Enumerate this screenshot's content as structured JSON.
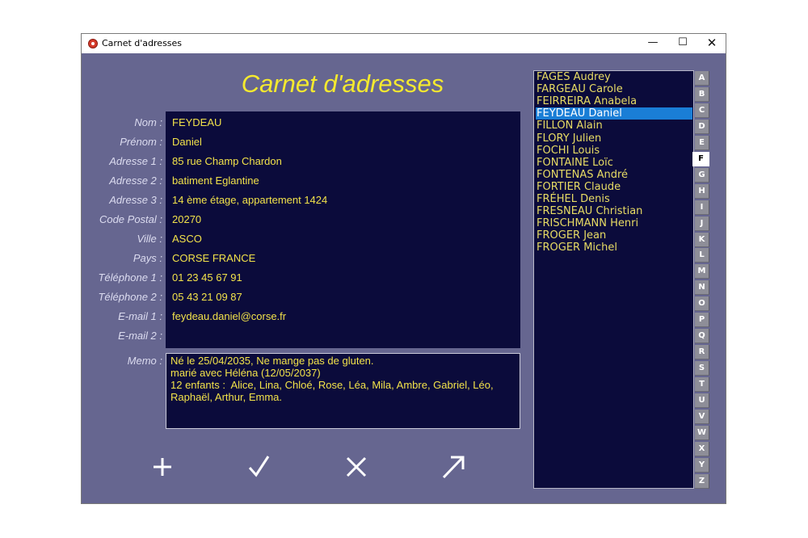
{
  "window": {
    "title": "Carnet d'adresses",
    "minimize": "—",
    "maximize": "☐",
    "close": "✕"
  },
  "header": {
    "title": "Carnet d'adresses"
  },
  "form": {
    "fields": [
      {
        "label": "Nom :",
        "value": "FEYDEAU"
      },
      {
        "label": "Prénom :",
        "value": "Daniel"
      },
      {
        "label": "Adresse 1 :",
        "value": "85 rue Champ Chardon"
      },
      {
        "label": "Adresse 2 :",
        "value": "batiment Eglantine"
      },
      {
        "label": "Adresse 3 :",
        "value": "14 ème étage, appartement 1424"
      },
      {
        "label": "Code Postal :",
        "value": "20270"
      },
      {
        "label": "Ville :",
        "value": "ASCO"
      },
      {
        "label": "Pays :",
        "value": "CORSE FRANCE"
      },
      {
        "label": "Téléphone 1 :",
        "value": "01 23 45 67 91"
      },
      {
        "label": "Téléphone 2 :",
        "value": "05 43 21 09 87"
      },
      {
        "label": "E-mail 1 :",
        "value": "feydeau.daniel@corse.fr"
      },
      {
        "label": "E-mail 2 :",
        "value": ""
      }
    ],
    "memo_label": "Memo :",
    "memo": "Né le 25/04/2035, Ne mange pas de gluten.\nmarié avec Héléna (12/05/2037)\n12 enfants :  Alice, Lina, Chloé, Rose, Léa, Mila, Ambre, Gabriel, Léo,\nRaphaël, Arthur, Emma."
  },
  "actions": [
    {
      "name": "add-icon"
    },
    {
      "name": "validate-icon"
    },
    {
      "name": "cancel-icon"
    },
    {
      "name": "export-icon"
    }
  ],
  "contacts": {
    "items": [
      "FAGES Audrey",
      "FARGEAU Carole",
      "FEIRREIRA Anabela",
      "FEYDEAU Daniel",
      "FILLON Alain",
      "FLORY Julien",
      "FOCHI Louis",
      "FONTAINE Loïc",
      "FONTENAS André",
      "FORTIER Claude",
      "FRÉHEL Denis",
      "FRESNEAU Christian",
      "FRISCHMANN Henri",
      "FROGER Jean",
      "FROGER Michel"
    ],
    "selected_index": 3
  },
  "alphabet": {
    "letters": [
      "A",
      "B",
      "C",
      "D",
      "E",
      "F",
      "G",
      "H",
      "I",
      "J",
      "K",
      "L",
      "M",
      "N",
      "O",
      "P",
      "Q",
      "R",
      "S",
      "T",
      "U",
      "V",
      "W",
      "X",
      "Y",
      "Z"
    ],
    "active": "F"
  },
  "colors": {
    "accent": "#f5ea2e",
    "selection": "#1a7ed6",
    "background": "#666690",
    "panel": "#0b0b3b"
  }
}
